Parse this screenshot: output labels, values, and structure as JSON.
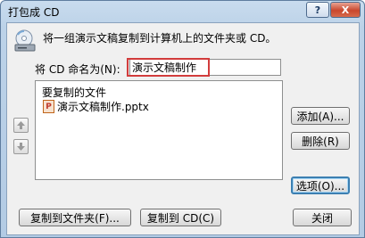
{
  "window": {
    "title": "打包成 CD"
  },
  "titlebar": {
    "help_label": "?",
    "close_label": "X"
  },
  "instruction": "将一组演示文稿复制到计算机上的文件夹或 CD。",
  "name_field": {
    "label": "将 CD 命名为(N):",
    "value": "演示文稿制作"
  },
  "file_list": {
    "header": "要复制的文件",
    "files": [
      {
        "name": "演示文稿制作.pptx",
        "icon": "pptx-file-icon"
      }
    ]
  },
  "buttons": {
    "add": "添加(A)...",
    "delete": "删除(R)",
    "options": "选项(O)...",
    "copy_folder": "复制到文件夹(F)...",
    "copy_cd": "复制到 CD(C)",
    "close": "关闭"
  },
  "colors": {
    "highlight_box": "#d23c3c",
    "close_button": "#c9462c"
  }
}
